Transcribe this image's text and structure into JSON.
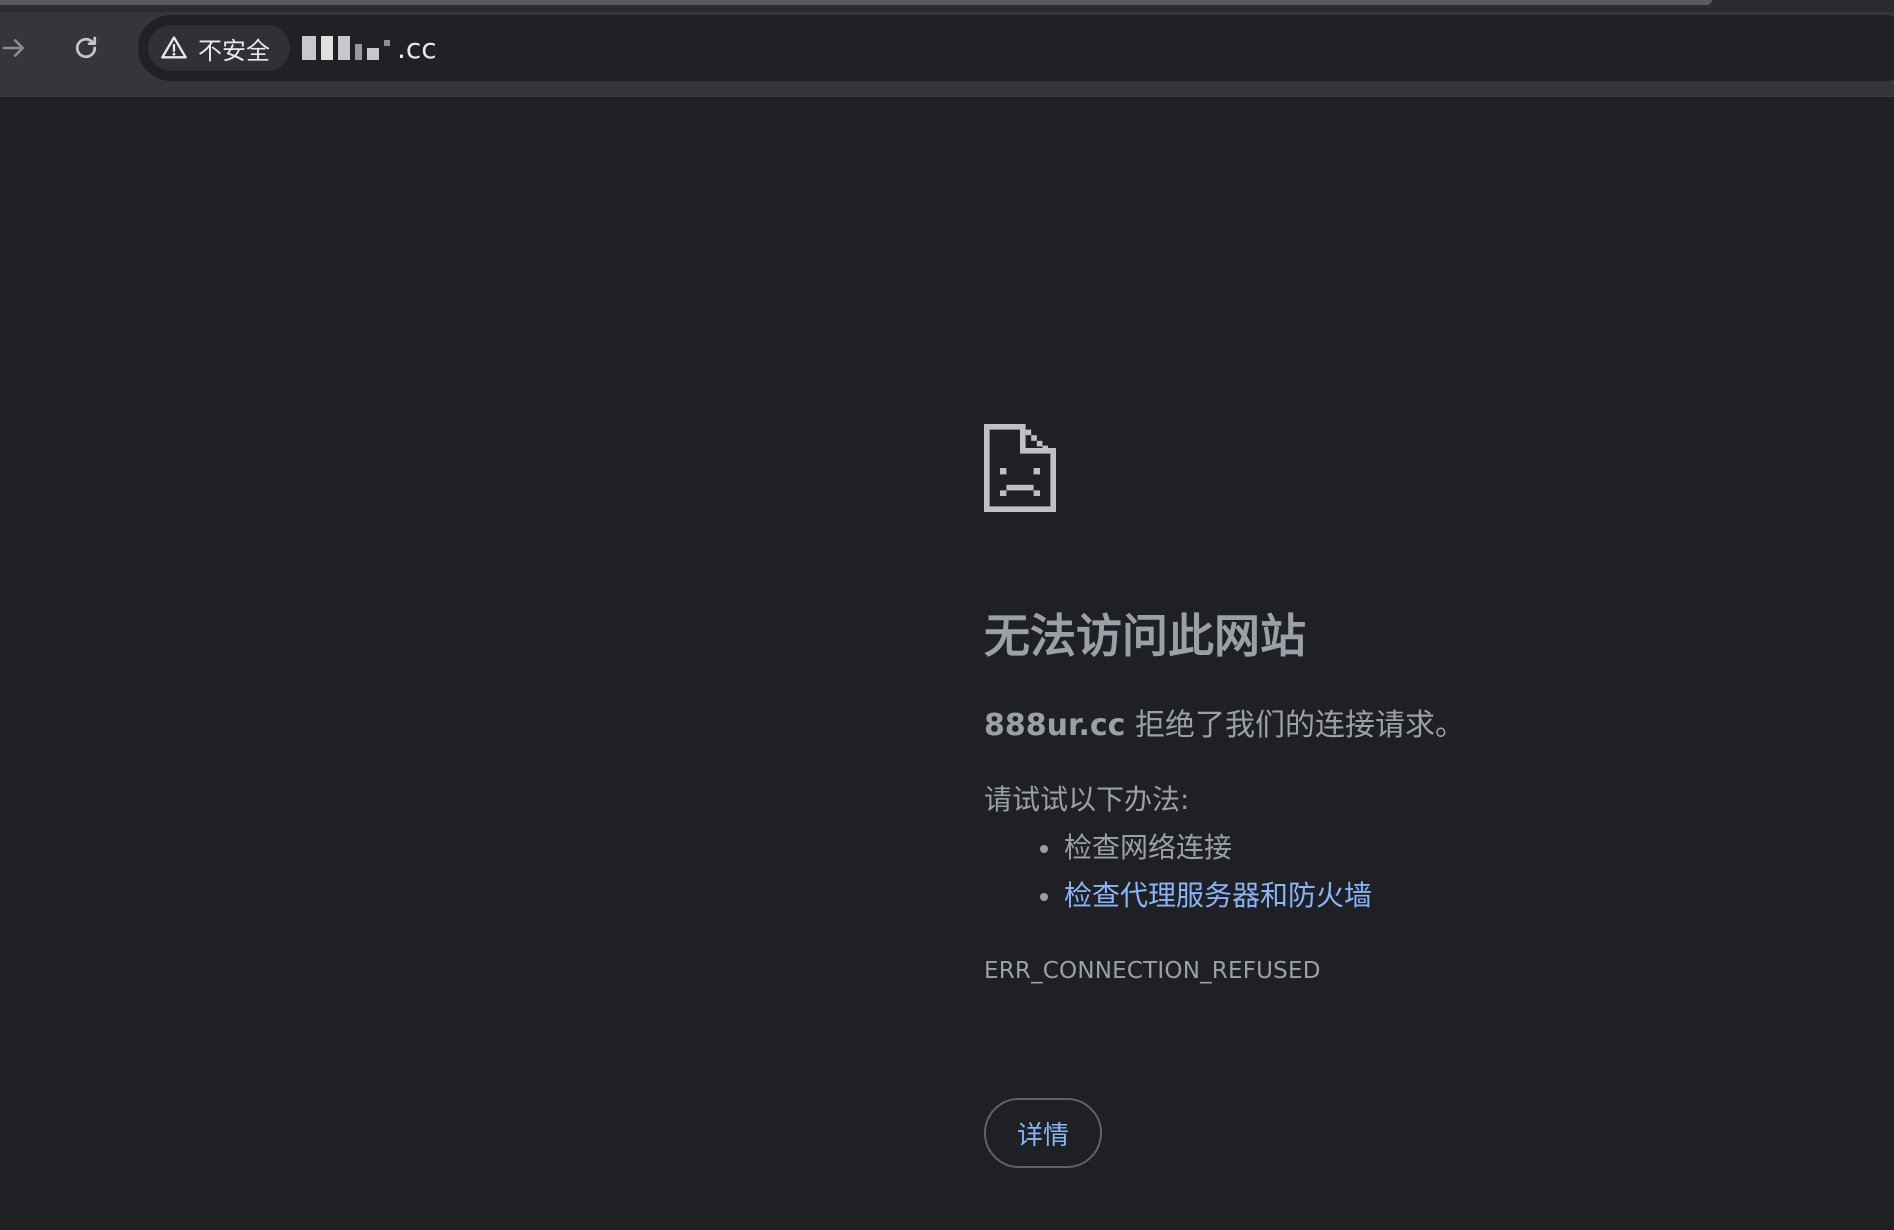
{
  "toolbar": {
    "security_label": "不安全",
    "url_suffix": ".cc",
    "icons": {
      "forward": "arrow-right-icon",
      "reload": "reload-icon",
      "security": "warning-triangle-icon"
    }
  },
  "error": {
    "icon": "sad-document-icon",
    "title": "无法访问此网站",
    "host": "888ur.cc",
    "message": " 拒绝了我们的连接请求。",
    "try_label": "请试试以下办法:",
    "suggestions": [
      {
        "text": "检查网络连接",
        "is_link": false
      },
      {
        "text": "检查代理服务器和防火墙",
        "is_link": true
      }
    ],
    "code": "ERR_CONNECTION_REFUSED",
    "details_label": "详情"
  },
  "colors": {
    "page_background": "#1f2024",
    "toolbar": "#35363a",
    "text": "#9aa0a6",
    "link": "#8ab4f8"
  }
}
